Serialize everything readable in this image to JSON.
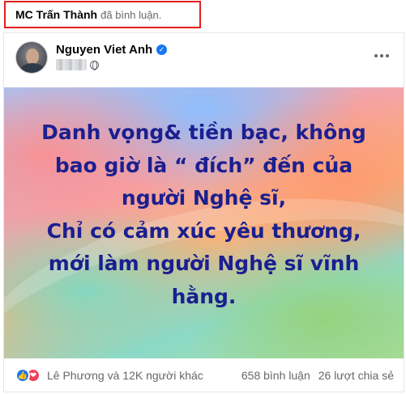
{
  "activity": {
    "actor": "MC Trấn Thành",
    "action": "đã bình luận."
  },
  "post": {
    "author": "Nguyen Viet Anh",
    "verified": true,
    "privacy_icon": "globe-icon",
    "menu_icon": "more-dots-icon",
    "image_text": [
      "Danh vọng& tiền bạc, không",
      "bao giờ là “ đích” đến của",
      "người Nghệ sĩ,",
      "Chỉ có cảm xúc yêu thương,",
      "mới làm người Nghệ sĩ vĩnh",
      "hằng."
    ],
    "text_color": "#1b1f8f"
  },
  "footer": {
    "reaction_icons": [
      "like-icon",
      "love-icon"
    ],
    "reactors": "Lê Phương và 12K người khác",
    "comments": "658 bình luận",
    "shares": "26 lượt chia sẻ"
  },
  "colors": {
    "highlight_border": "#e0201d",
    "like": "#1877f2",
    "love": "#f33e58"
  }
}
